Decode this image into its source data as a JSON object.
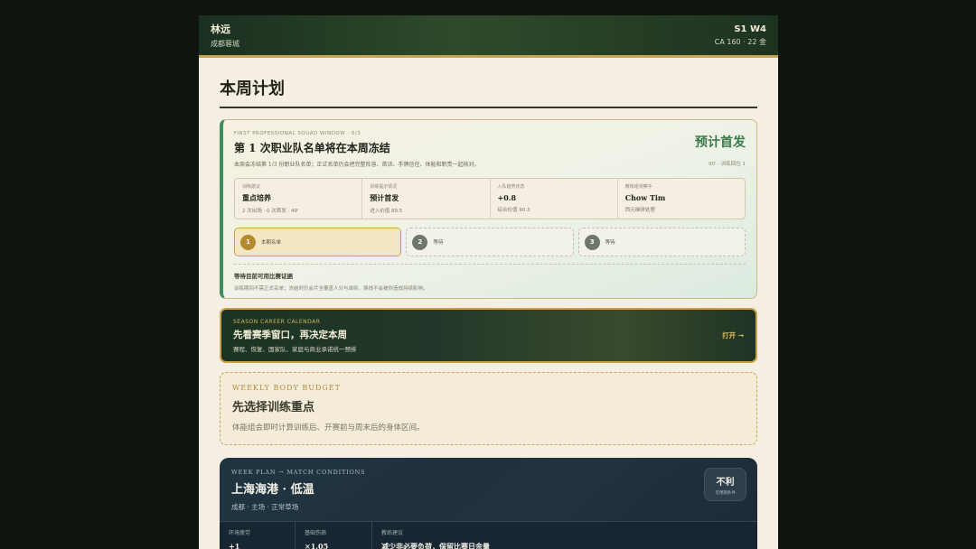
{
  "header": {
    "player_name": "林远",
    "club": "成都蓉城",
    "season_week": "S1 W4",
    "ca_info": "CA 160 · 22 金"
  },
  "page": {
    "title": "本周计划"
  },
  "squad_window": {
    "eyebrow": "FIRST PROFESSIONAL SQUAD WINDOW · 0/3",
    "headline": "第 1 次职业队名单将在本周冻结",
    "description": "本周会冻结第 1/3 份职业队名单；正式名单仍会把完整阵容、首训、手牌信任、体能和职责一起核对。",
    "projection": "预计首发",
    "projection_note": "90' · 训练回位 1",
    "stats": [
      {
        "key": "训练建议",
        "value": "重点培养",
        "sub": "2 次出场 · 0 次首发 · 49'"
      },
      {
        "key": "训练提示情况",
        "value": "预计首发",
        "sub": "进入价值 89.5"
      },
      {
        "key": "入队趋势状态",
        "value": "+0.8",
        "sub": "综合价值 90.3"
      },
      {
        "key": "教练组观察手",
        "value": "Chow Tim",
        "sub": "西元梯研处理"
      }
    ],
    "steps": [
      {
        "num": "1",
        "label": "本期名单",
        "active": true
      },
      {
        "num": "2",
        "label": "等待",
        "active": false
      },
      {
        "num": "3",
        "label": "等待",
        "active": false
      }
    ],
    "wait_title": "等待目前可用比赛证据",
    "wait_desc": "训练期间不需正式名单；冻结时仍会片全覆盖人分与准则，换线不会被你造成持续影响。"
  },
  "calendar": {
    "eyebrow": "SEASON CAREER CALENDAR",
    "title": "先看赛季窗口，再决定本周",
    "subtitle": "赛程、恢复、国家队、家庭与商业承诺统一预排",
    "open_label": "打开 →"
  },
  "budget": {
    "eyebrow": "WEEKLY BODY BUDGET",
    "title": "先选择训练重点",
    "description": "体能组会即时计算训练后、开赛前与周末后的身体区间。"
  },
  "week_plan": {
    "eyebrow": "WEEK PLAN → MATCH CONDITIONS",
    "title": "上海海港 · 低温",
    "subtitle": "成都 · 主场 · 正常草场",
    "badge_main": "不利",
    "badge_sub": "可预期条件",
    "metrics": [
      {
        "key": "环境疲劳",
        "value": "+1"
      },
      {
        "key": "基础伤病",
        "value": "×1.05"
      },
      {
        "key": "教练建议",
        "value": "减少非必要负荷，保留比赛日余量"
      }
    ]
  },
  "colors": {
    "accent_gold": "#c9a24a",
    "forest_green": "#1a3020",
    "success_green": "#3f8d5c",
    "slate_blue": "#1f3340"
  }
}
